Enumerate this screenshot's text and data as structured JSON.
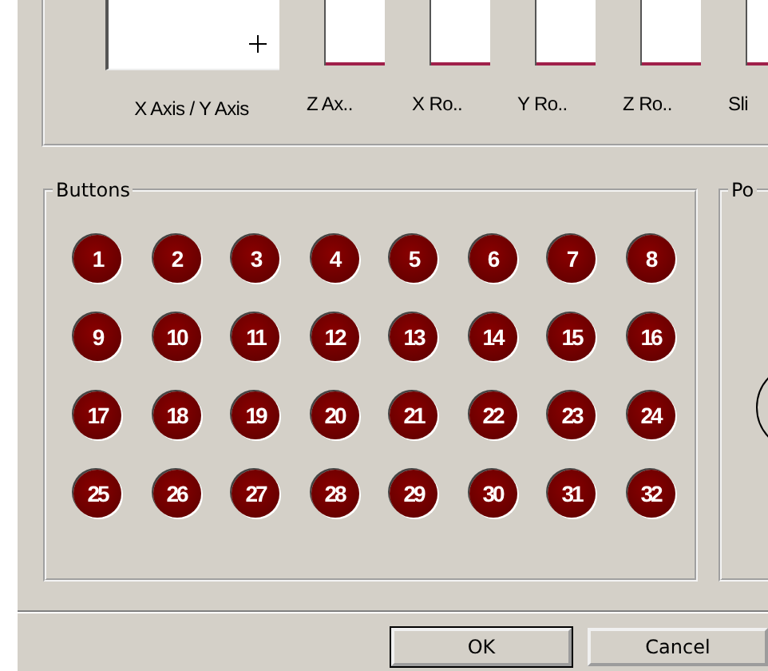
{
  "axes": [
    {
      "label": "X Axis / Y Axis",
      "kind": "xy"
    },
    {
      "label": "Z Ax..",
      "kind": "bar",
      "level": 0
    },
    {
      "label": "X Ro..",
      "kind": "bar",
      "level": 0
    },
    {
      "label": "Y Ro..",
      "kind": "bar",
      "level": 0
    },
    {
      "label": "Z Ro..",
      "kind": "bar",
      "level": 0
    },
    {
      "label": "Sli",
      "kind": "bar",
      "level": 0
    }
  ],
  "buttons_group": {
    "title": "Buttons",
    "buttons": [
      "1",
      "2",
      "3",
      "4",
      "5",
      "6",
      "7",
      "8",
      "9",
      "10",
      "11",
      "12",
      "13",
      "14",
      "15",
      "16",
      "17",
      "18",
      "19",
      "20",
      "21",
      "22",
      "23",
      "24",
      "25",
      "26",
      "27",
      "28",
      "29",
      "30",
      "31",
      "32"
    ]
  },
  "pov_group": {
    "title": "Po"
  },
  "dialog_buttons": [
    {
      "label": "OK",
      "default": true
    },
    {
      "label": "Cancel",
      "default": false
    }
  ]
}
